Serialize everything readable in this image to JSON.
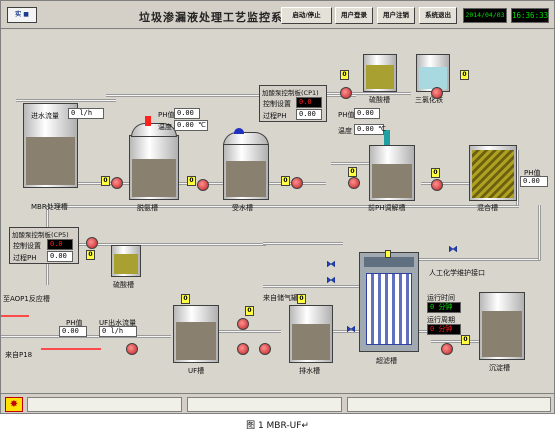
{
  "header": {
    "logo_text": "实 ■",
    "title": "垃圾渗漏液处理工艺监控系统",
    "buttons": [
      "启动/停止",
      "用户登录",
      "用户注销",
      "系统退出"
    ],
    "date": "2014/04/03",
    "time": "16:36:33"
  },
  "panels": {
    "cp1": {
      "title": "加酸泵控制板(CP1)",
      "setpoint_label": "控制设置",
      "setpoint_value": "0.0",
      "process_label": "过程PH",
      "process_value": "0.00"
    },
    "cp5": {
      "title": "加酸泵控制板(CP5)",
      "setpoint_label": "控制设置",
      "setpoint_value": "0.0",
      "process_label": "过程PH",
      "process_value": "0.00"
    }
  },
  "readouts": {
    "inflow_label": "进水流量",
    "inflow_value": "0",
    "inflow_unit": "l/h",
    "deamm_ph_label": "PH值",
    "deamm_ph_value": "0.00",
    "deamm_temp_label": "温度",
    "deamm_temp_value": "0.00",
    "deamm_temp_unit": "℃",
    "prph_ph_label": "PH值",
    "prph_ph_value": "0.00",
    "prph_temp_label": "温度",
    "prph_temp_value": "0.00",
    "prph_temp_unit": "℃",
    "mix_ph_label": "PH值",
    "mix_ph_value": "0.00",
    "uf_ph_label": "PH值",
    "uf_ph_value": "0.00",
    "uf_out_label": "UF出水流量",
    "uf_out_value": "0",
    "uf_out_unit": "l/h",
    "run_time_label": "运行时间",
    "run_time_value": "0",
    "run_time_unit": "分钟",
    "run_cycle_label": "运行周期",
    "run_cycle_value": "0",
    "run_cycle_unit": "分钟"
  },
  "tank_labels": {
    "mbr": "MBR处理槽",
    "deamm": "脱氨槽",
    "recv": "受水槽",
    "sulfuric_top": "硫酸槽",
    "ferric": "三氯化铁",
    "preph": "前PH调解槽",
    "mix": "混合槽",
    "sulfuric_mid": "硫酸槽",
    "uf": "UF槽",
    "drain": "排水槽",
    "ultra": "超滤槽",
    "settle": "沉淀槽"
  },
  "flow_labels": {
    "to_aop": "至AOP1反应槽",
    "from_p18": "来自P18",
    "self_air": "来自储气罐",
    "ai_port": "人工化学维护接口"
  },
  "indicators": [
    "0",
    "0",
    "0",
    "0",
    "0",
    "0",
    "0",
    "0",
    "0",
    "0",
    "0",
    "0"
  ],
  "caption": "图 1  MBR-UF↵",
  "colors": {
    "lcd_bg": "#000000",
    "lcd_fg": "#00e000",
    "pump": "#d03030",
    "alarm": "#ff2020"
  }
}
